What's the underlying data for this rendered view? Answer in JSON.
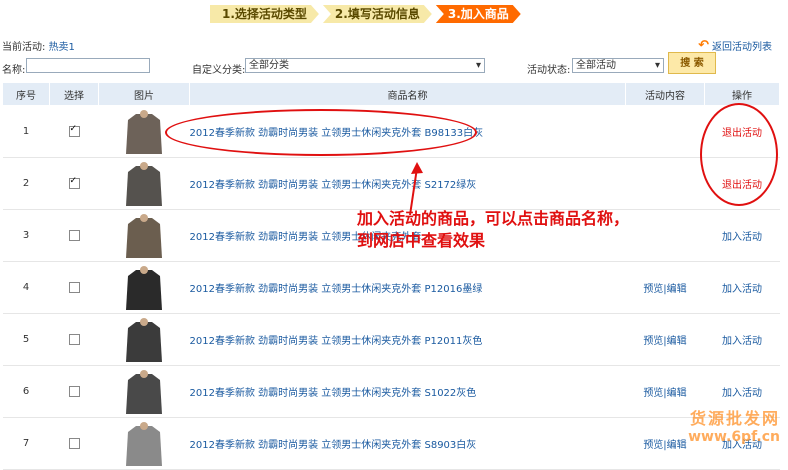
{
  "steps": [
    "1.选择活动类型",
    "2.填写活动信息",
    "3.加入商品"
  ],
  "current": {
    "label": "当前活动:",
    "value": "热卖1"
  },
  "back_label": "返回活动列表",
  "filter": {
    "name_label": "名称:",
    "category_label": "自定义分类:",
    "category_value": "全部分类",
    "status_label": "活动状态:",
    "status_value": "全部活动",
    "search_label": "搜 索"
  },
  "columns": [
    "序号",
    "选择",
    "图片",
    "商品名称",
    "活动内容",
    "操作"
  ],
  "rows": [
    {
      "no": "1",
      "checked": true,
      "name": "2012春季新款  劲霸时尚男装  立领男士休闲夹克外套  B98133白灰",
      "content": "",
      "op": "退出活动"
    },
    {
      "no": "2",
      "checked": true,
      "name": "2012春季新款  劲霸时尚男装  立领男士休闲夹克外套  S2172绿灰",
      "content": "",
      "op": "退出活动"
    },
    {
      "no": "3",
      "checked": false,
      "name": "2012春季新款  劲霸时尚男装  立领男士休闲夹克外套",
      "content": "",
      "op": "加入活动"
    },
    {
      "no": "4",
      "checked": false,
      "name": "2012春季新款  劲霸时尚男装  立领男士休闲夹克外套  P12016墨绿",
      "content": "预览|编辑",
      "op": "加入活动"
    },
    {
      "no": "5",
      "checked": false,
      "name": "2012春季新款  劲霸时尚男装  立领男士休闲夹克外套  P12011灰色",
      "content": "预览|编辑",
      "op": "加入活动"
    },
    {
      "no": "6",
      "checked": false,
      "name": "2012春季新款  劲霸时尚男装  立领男士休闲夹克外套  S1022灰色",
      "content": "预览|编辑",
      "op": "加入活动"
    },
    {
      "no": "7",
      "checked": false,
      "name": "2012春季新款  劲霸时尚男装  立领男士休闲夹克外套  S8903白灰",
      "content": "预览|编辑",
      "op": "加入活动"
    }
  ],
  "annotation": [
    "加入活动的商品，可以点击商品名称，",
    "到网店中查看效果"
  ],
  "watermark": [
    "货源批发网",
    "www.6pf.cn"
  ],
  "colors": {
    "accent": "#ff6a00",
    "link": "#1a5aa0",
    "alert": "#e01010"
  }
}
